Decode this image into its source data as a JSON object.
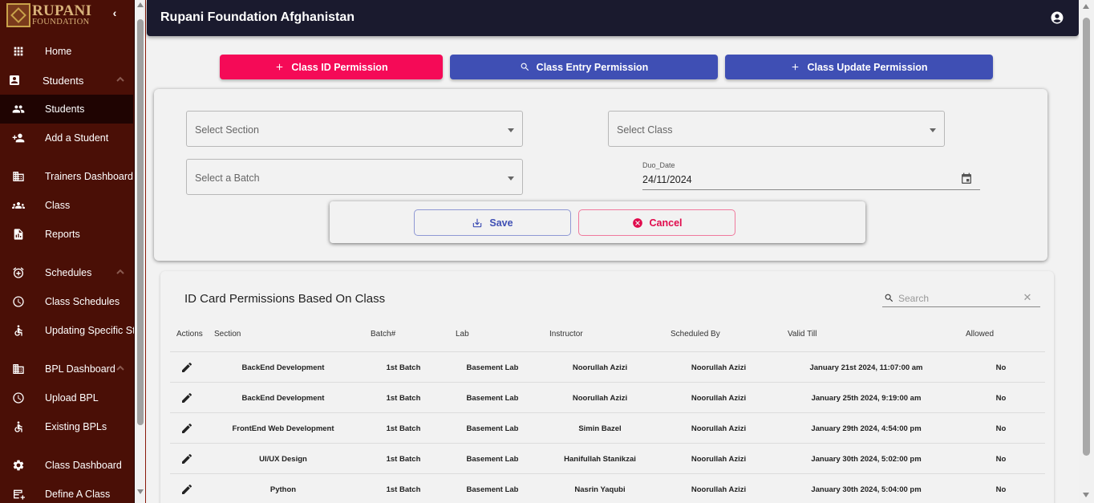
{
  "brand": {
    "line1": "RUPANI",
    "line2": "FOUNDATION"
  },
  "header": {
    "title": "Rupani Foundation Afghanistan"
  },
  "sidebar": {
    "items": [
      {
        "label": "Home"
      },
      {
        "label": "Students"
      },
      {
        "label": "Students"
      },
      {
        "label": "Add a Student"
      },
      {
        "label": "Trainers Dashboard"
      },
      {
        "label": "Class"
      },
      {
        "label": "Reports"
      },
      {
        "label": "Schedules"
      },
      {
        "label": "Class Schedules"
      },
      {
        "label": "Updating Specific St"
      },
      {
        "label": "BPL Dashboard"
      },
      {
        "label": "Upload BPL"
      },
      {
        "label": "Existing BPLs"
      },
      {
        "label": "Class Dashboard"
      },
      {
        "label": "Define A Class"
      }
    ]
  },
  "tabs": [
    {
      "label": "Class ID Permission"
    },
    {
      "label": "Class Entry Permission"
    },
    {
      "label": "Class Update Permission"
    }
  ],
  "form": {
    "section_placeholder": "Select Section",
    "class_placeholder": "Select Class",
    "batch_placeholder": "Select a Batch",
    "date_label": "Duo_Date",
    "date_value": "24/11/2024",
    "save_label": "Save",
    "cancel_label": "Cancel"
  },
  "table": {
    "title": "ID Card Permissions Based On Class",
    "search_placeholder": "Search",
    "columns": [
      "Actions",
      "Section",
      "Batch#",
      "Lab",
      "Instructor",
      "Scheduled By",
      "Valid Till",
      "Allowed"
    ],
    "rows": [
      [
        "BackEnd Development",
        "1st Batch",
        "Basement Lab",
        "Noorullah Azizi",
        "Noorullah Azizi",
        "January 21st 2024, 11:07:00 am",
        "No"
      ],
      [
        "BackEnd Development",
        "1st Batch",
        "Basement Lab",
        "Noorullah Azizi",
        "Noorullah Azizi",
        "January 25th 2024, 9:19:00 am",
        "No"
      ],
      [
        "FrontEnd Web Development",
        "1st Batch",
        "Basement Lab",
        "Simin Bazel",
        "Noorullah Azizi",
        "January 29th 2024, 4:54:00 pm",
        "No"
      ],
      [
        "UI/UX Design",
        "1st Batch",
        "Basement Lab",
        "Hanifullah Stanikzai",
        "Noorullah Azizi",
        "January 30th 2024, 5:02:00 pm",
        "No"
      ],
      [
        "Python",
        "1st Batch",
        "Basement Lab",
        "Nasrin Yaqubi",
        "Noorullah Azizi",
        "January 30th 2024, 5:04:00 pm",
        "No"
      ]
    ]
  },
  "colors": {
    "sidebar_bg": "#4a0f06",
    "topbar_bg": "#1a1a2e",
    "primary": "#3f4fb4",
    "accent": "#f50a57"
  }
}
